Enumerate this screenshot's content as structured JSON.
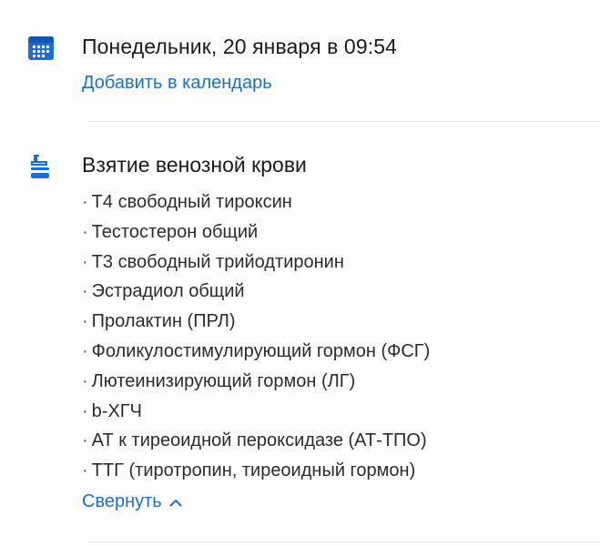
{
  "appointment": {
    "datetime": "Понедельник, 20 января в 09:54",
    "add_to_calendar": "Добавить в календарь"
  },
  "analysis": {
    "title": "Взятие венозной крови",
    "bullet": "·",
    "tests": [
      "Т4 свободный тироксин",
      "Тестостерон общий",
      "Т3 свободный трийодтиронин",
      "Эстрадиол общий",
      "Пролактин (ПРЛ)",
      "Фоликулостимулирующий гормон (ФСГ)",
      "Лютеинизирующий гормон (ЛГ)",
      "b-ХГЧ",
      "АТ к тиреоидной пероксидазе (АТ-ТПО)",
      "ТТГ (тиротропин, тиреоидный гормон)"
    ],
    "collapse_label": "Свернуть"
  },
  "icons": {
    "calendar": "calendar-icon",
    "tube": "test-tube-icon",
    "collapse": "chevron-up-icon"
  },
  "colors": {
    "accent": "#1a6fd6",
    "text": "#1a1a1a",
    "divider": "#e6e6e6"
  }
}
